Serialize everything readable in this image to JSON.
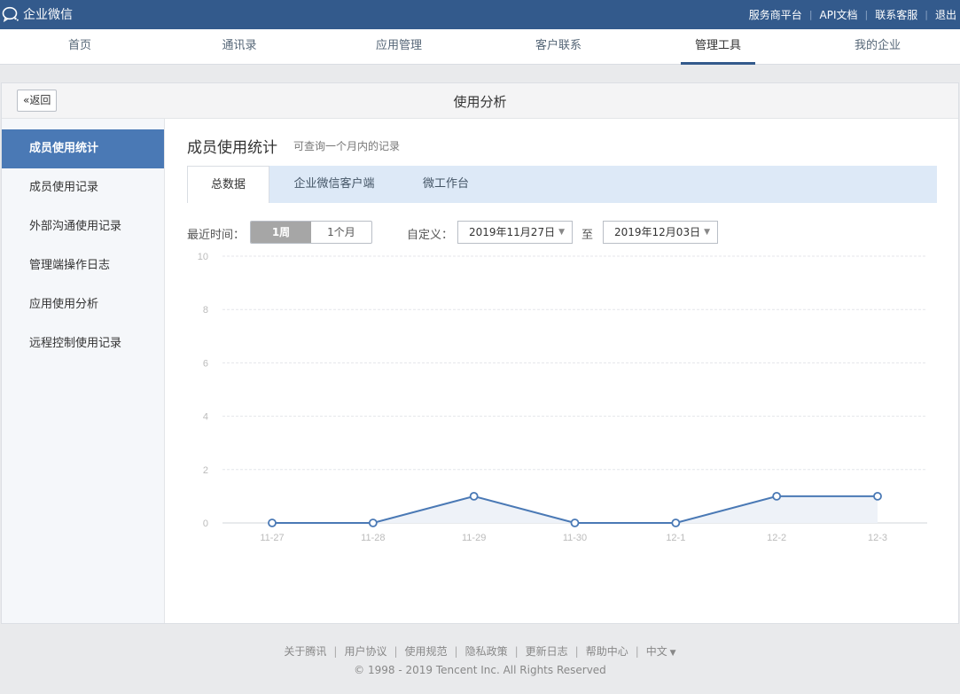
{
  "topbar": {
    "brand": "企业微信",
    "links": [
      "服务商平台",
      "API文档",
      "联系客服",
      "退出"
    ]
  },
  "nav": {
    "items": [
      "首页",
      "通讯录",
      "应用管理",
      "客户联系",
      "管理工具",
      "我的企业"
    ],
    "active_index": 4
  },
  "panel": {
    "back_label": "返回",
    "title": "使用分析"
  },
  "sidebar": {
    "items": [
      "成员使用统计",
      "成员使用记录",
      "外部沟通使用记录",
      "管理端操作日志",
      "应用使用分析",
      "远程控制使用记录"
    ],
    "active_index": 0
  },
  "content": {
    "title": "成员使用统计",
    "subtitle": "可查询一个月内的记录",
    "tabs": [
      "总数据",
      "企业微信客户端",
      "微工作台"
    ],
    "active_tab": 0
  },
  "filters": {
    "recent_label": "最近时间：",
    "range_options": [
      "1周",
      "1个月"
    ],
    "range_selected": "1周",
    "custom_label": "自定义：",
    "start_date": "2019年11月27日",
    "to_label": "至",
    "end_date": "2019年12月03日"
  },
  "chart_data": {
    "type": "area",
    "categories": [
      "11-27",
      "11-28",
      "11-29",
      "11-30",
      "12-1",
      "12-2",
      "12-3"
    ],
    "values": [
      0,
      0,
      1,
      0,
      0,
      1,
      1
    ],
    "ylim": [
      0,
      10
    ],
    "yticks": [
      0,
      2,
      4,
      6,
      8,
      10
    ],
    "grid": true,
    "line_color": "#4a79b5",
    "fill_color": "#eef2f8",
    "title": "",
    "xlabel": "",
    "ylabel": ""
  },
  "footer": {
    "links": [
      "关于腾讯",
      "用户协议",
      "使用规范",
      "隐私政策",
      "更新日志",
      "帮助中心",
      "中文"
    ],
    "copyright": "© 1998 - 2019 Tencent Inc. All Rights Reserved"
  },
  "colors": {
    "topbar": "#335a8c",
    "accent": "#4a79b5",
    "tab_bar": "#dde9f7"
  }
}
